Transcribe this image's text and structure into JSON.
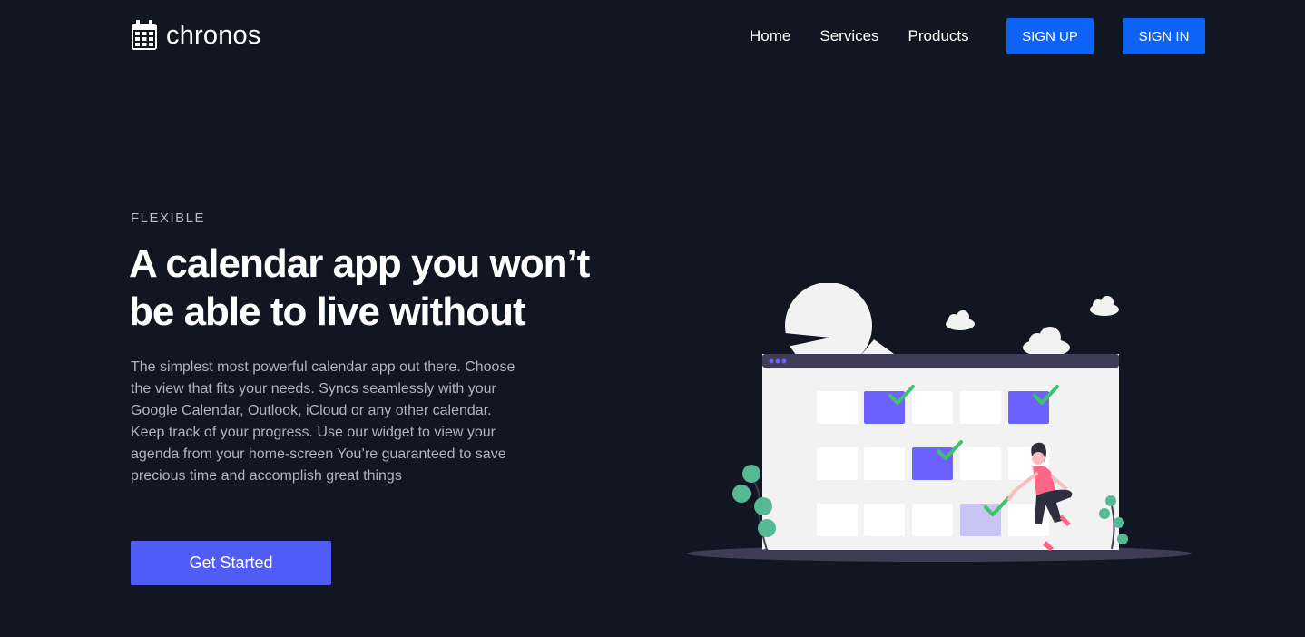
{
  "header": {
    "logo_text": "chronos",
    "logo_icon": "calendar-icon",
    "nav": [
      {
        "label": "Home"
      },
      {
        "label": "Services"
      },
      {
        "label": "Products"
      }
    ],
    "signup_label": "SIGN UP",
    "signin_label": "SIGN IN"
  },
  "hero": {
    "eyebrow": "FLEXIBLE",
    "headline": "A calendar app you won’t be able to live without",
    "description": "The simplest most powerful calendar app out there. Choose the view that fits your needs. Syncs seamlessly with your Google Calendar, Outlook, iCloud or any other calendar. Keep track of your progress. Use our widget to view your agenda from your home-screen You’re guaranteed to save precious time and accomplish great things",
    "cta_label": "Get Started"
  },
  "colors": {
    "background": "#111622",
    "primary_button": "#0d63f8",
    "cta_button": "#4f5cf5",
    "accent_purple": "#6c63ff",
    "check_green": "#3dc46b"
  }
}
